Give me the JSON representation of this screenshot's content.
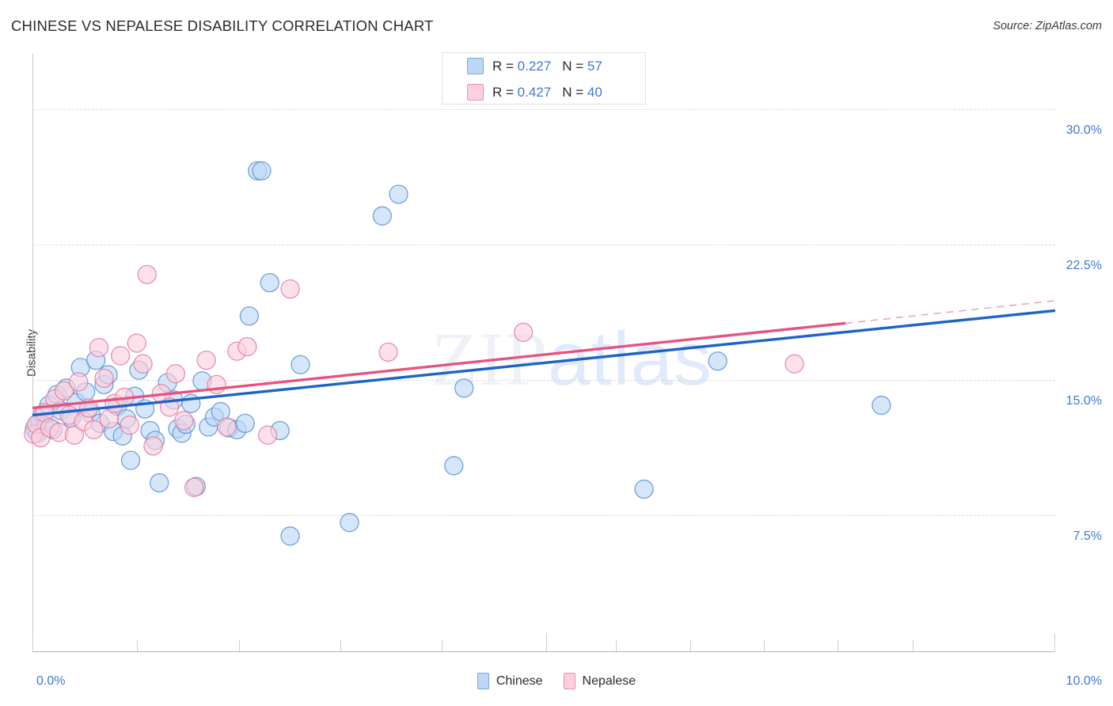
{
  "header": {
    "title": "CHINESE VS NEPALESE DISABILITY CORRELATION CHART",
    "source": "Source: ZipAtlas.com"
  },
  "watermark": {
    "part1": "ZIP",
    "part2": "atlas"
  },
  "stats": {
    "rows": [
      {
        "series": "Chinese",
        "r_label": "R = ",
        "r_value": "0.227",
        "n_label": "N = ",
        "n_value": "57",
        "color": "#bdd7f5"
      },
      {
        "series": "Nepalese",
        "r_label": "R = ",
        "r_value": "0.427",
        "n_value": "40",
        "n_label": "N = ",
        "color": "#fbcfdd"
      }
    ]
  },
  "legend": {
    "items": [
      {
        "label": "Chinese",
        "color": "#bdd7f5",
        "border": "#7aa8df"
      },
      {
        "label": "Nepalese",
        "color": "#fbcfdd",
        "border": "#e692ad"
      }
    ]
  },
  "chart_data": {
    "type": "scatter",
    "title": "CHINESE VS NEPALESE DISABILITY CORRELATION CHART",
    "xlabel": "",
    "ylabel": "Disability",
    "xlim": [
      0.0,
      10.0
    ],
    "ylim": [
      0.0,
      33.0
    ],
    "x_tick_labels": [
      "0.0%",
      "10.0%"
    ],
    "y_tick_labels": [
      "30.0%",
      "22.5%",
      "15.0%",
      "7.5%"
    ],
    "y_ticks": [
      30.0,
      22.5,
      15.0,
      7.5
    ],
    "grid": true,
    "legend_position": "bottom-center",
    "axis_label_color": "#3f77d4",
    "series": [
      {
        "name": "Chinese",
        "color": "#bdd7f5",
        "border": "#5b92d8",
        "R": 0.227,
        "N": 57,
        "trend": {
          "x0": 0.0,
          "y0": 13.05,
          "x1": 10.0,
          "y1": 18.85,
          "color": "#1f63c8"
        },
        "points": [
          [
            0.02,
            12.3
          ],
          [
            0.05,
            12.05
          ],
          [
            0.07,
            12.7
          ],
          [
            0.1,
            13.1
          ],
          [
            0.13,
            12.45
          ],
          [
            0.16,
            13.6
          ],
          [
            0.2,
            12.25
          ],
          [
            0.24,
            14.2
          ],
          [
            0.28,
            13.3
          ],
          [
            0.33,
            14.55
          ],
          [
            0.38,
            12.9
          ],
          [
            0.43,
            13.75
          ],
          [
            0.47,
            15.7
          ],
          [
            0.52,
            14.35
          ],
          [
            0.57,
            13.15
          ],
          [
            0.62,
            16.1
          ],
          [
            0.66,
            12.6
          ],
          [
            0.7,
            14.75
          ],
          [
            0.74,
            15.3
          ],
          [
            0.79,
            12.15
          ],
          [
            0.83,
            13.55
          ],
          [
            0.88,
            11.9
          ],
          [
            0.92,
            12.85
          ],
          [
            0.96,
            10.55
          ],
          [
            1.0,
            14.1
          ],
          [
            1.04,
            15.55
          ],
          [
            1.1,
            13.4
          ],
          [
            1.15,
            12.2
          ],
          [
            1.2,
            11.65
          ],
          [
            1.24,
            9.3
          ],
          [
            1.32,
            14.85
          ],
          [
            1.38,
            13.9
          ],
          [
            1.42,
            12.3
          ],
          [
            1.46,
            12.05
          ],
          [
            1.5,
            12.55
          ],
          [
            1.55,
            13.7
          ],
          [
            1.6,
            9.1
          ],
          [
            1.66,
            14.95
          ],
          [
            1.72,
            12.4
          ],
          [
            1.78,
            12.95
          ],
          [
            1.84,
            13.25
          ],
          [
            1.92,
            12.35
          ],
          [
            2.0,
            12.25
          ],
          [
            2.08,
            12.6
          ],
          [
            2.12,
            18.55
          ],
          [
            2.2,
            26.6
          ],
          [
            2.24,
            26.6
          ],
          [
            2.32,
            20.4
          ],
          [
            2.42,
            12.2
          ],
          [
            2.52,
            6.35
          ],
          [
            2.62,
            15.85
          ],
          [
            3.1,
            7.1
          ],
          [
            3.42,
            24.1
          ],
          [
            3.58,
            25.3
          ],
          [
            4.12,
            10.25
          ],
          [
            4.22,
            14.55
          ],
          [
            5.98,
            8.95
          ],
          [
            6.7,
            16.05
          ],
          [
            8.3,
            13.6
          ]
        ]
      },
      {
        "name": "Nepalese",
        "color": "#fbcfdd",
        "border": "#e37ea0",
        "R": 0.427,
        "N": 40,
        "trend": {
          "x0": 0.0,
          "y0": 13.45,
          "x1": 7.95,
          "y1": 18.15,
          "color": "#e8527f"
        },
        "trend_dashed": {
          "x0": 7.95,
          "y0": 18.15,
          "x1": 10.0,
          "y1": 19.4,
          "color": "#e8a7bd"
        },
        "points": [
          [
            0.01,
            12.0
          ],
          [
            0.04,
            12.55
          ],
          [
            0.08,
            11.8
          ],
          [
            0.12,
            13.2
          ],
          [
            0.17,
            12.35
          ],
          [
            0.22,
            13.95
          ],
          [
            0.26,
            12.1
          ],
          [
            0.31,
            14.4
          ],
          [
            0.36,
            13.05
          ],
          [
            0.41,
            11.95
          ],
          [
            0.45,
            14.9
          ],
          [
            0.5,
            12.7
          ],
          [
            0.55,
            13.45
          ],
          [
            0.6,
            12.25
          ],
          [
            0.65,
            16.8
          ],
          [
            0.7,
            15.1
          ],
          [
            0.75,
            12.85
          ],
          [
            0.8,
            13.7
          ],
          [
            0.86,
            16.35
          ],
          [
            0.9,
            14.05
          ],
          [
            0.95,
            12.5
          ],
          [
            1.02,
            17.05
          ],
          [
            1.08,
            15.9
          ],
          [
            1.12,
            20.85
          ],
          [
            1.18,
            11.35
          ],
          [
            1.26,
            14.25
          ],
          [
            1.34,
            13.5
          ],
          [
            1.4,
            15.35
          ],
          [
            1.48,
            12.75
          ],
          [
            1.58,
            9.05
          ],
          [
            1.7,
            16.1
          ],
          [
            1.8,
            14.75
          ],
          [
            1.9,
            12.4
          ],
          [
            2.0,
            16.6
          ],
          [
            2.1,
            16.85
          ],
          [
            2.3,
            11.95
          ],
          [
            2.52,
            20.05
          ],
          [
            3.48,
            16.55
          ],
          [
            4.8,
            17.65
          ],
          [
            7.45,
            15.9
          ]
        ]
      }
    ]
  }
}
